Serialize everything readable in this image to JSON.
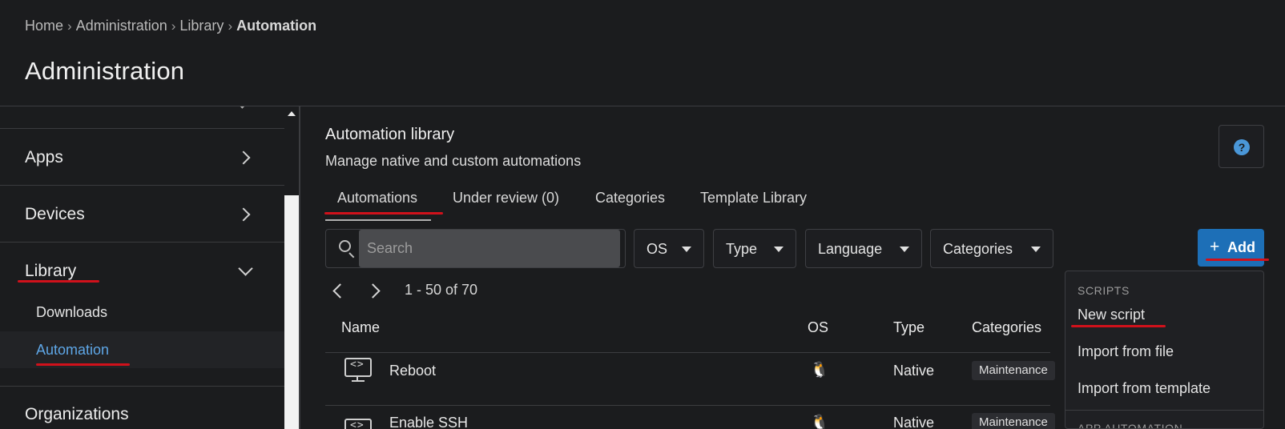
{
  "breadcrumb": [
    "Home",
    "Administration",
    "Library",
    "Automation"
  ],
  "page_title": "Administration",
  "sidebar": {
    "items": [
      {
        "label": "Apps"
      },
      {
        "label": "Devices"
      },
      {
        "label": "Library",
        "expanded": true,
        "children": [
          {
            "label": "Downloads",
            "active": false
          },
          {
            "label": "Automation",
            "active": true
          }
        ]
      },
      {
        "label": "Organizations"
      }
    ]
  },
  "main": {
    "title": "Automation library",
    "subtitle": "Manage native and custom automations",
    "help_icon": "question-mark",
    "tabs": [
      "Automations",
      "Under review (0)",
      "Categories",
      "Template Library"
    ],
    "active_tab": "Automations",
    "search": {
      "placeholder": "Search",
      "value": ""
    },
    "filters": [
      "OS",
      "Type",
      "Language",
      "Categories"
    ],
    "add_button": {
      "label": "Add",
      "icon": "plus",
      "color": "#1d6fb7"
    },
    "pager": {
      "range": "1 - 50 of 70"
    },
    "table": {
      "columns": [
        "Name",
        "OS",
        "Type",
        "Categories"
      ],
      "rows": [
        {
          "name": "Reboot",
          "os_icon": "linux",
          "type": "Native",
          "category": "Maintenance"
        },
        {
          "name": "Enable SSH",
          "os_icon": "linux",
          "type": "Native",
          "category": "Maintenance"
        }
      ]
    }
  },
  "add_menu": {
    "scripts_header": "SCRIPTS",
    "items": [
      "New script",
      "Import from file",
      "Import from template"
    ],
    "app_automation_header": "APP AUTOMATION"
  },
  "colors": {
    "accent": "#5ea6e6",
    "primary_button": "#1d6fb7",
    "annotation_red": "#d0111b",
    "background": "#1b1c1e"
  }
}
